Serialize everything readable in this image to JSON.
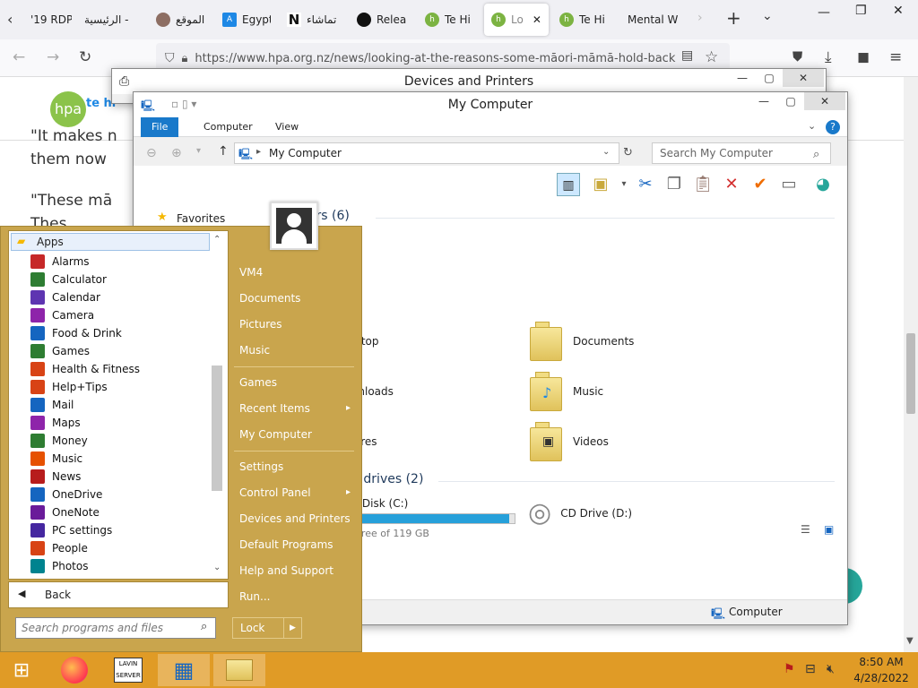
{
  "browser": {
    "tabs": [
      {
        "label": "'19 RDP"
      },
      {
        "label": "الرئيسية -"
      },
      {
        "label": "الموقع"
      },
      {
        "label": "Egypt"
      },
      {
        "label": "تماشاء"
      },
      {
        "label": "Relea"
      },
      {
        "label": "Te Hi"
      },
      {
        "label": "Lo"
      },
      {
        "label": "Te Hi"
      },
      {
        "label": "Mental W"
      }
    ],
    "url": "https://www.hpa.org.nz/news/looking-at-the-reasons-some-māori-māmā-hold-back",
    "window_controls": {
      "minimize": "—",
      "restore": "❐",
      "close": "✕"
    }
  },
  "page": {
    "logo_text": "hpa",
    "logo_sub": "te hi",
    "text_line1": "\"It makes n",
    "text_line2": "them now",
    "text_line3": "\"These mā",
    "text_line4": "Thes"
  },
  "devices_window": {
    "title": "Devices and Printers"
  },
  "explorer": {
    "title": "My Computer",
    "ribbon_tabs": [
      "File",
      "Computer",
      "View"
    ],
    "address": "My Computer",
    "search_placeholder": "Search My Computer",
    "nav_favorites": "Favorites",
    "folders_header": "Folders (6)",
    "folders": [
      {
        "name": "Desktop"
      },
      {
        "name": "Documents"
      },
      {
        "name": "Downloads"
      },
      {
        "name": "Music"
      },
      {
        "name": "Pictures"
      },
      {
        "name": "Videos"
      }
    ],
    "drives_header": "Devices and drives (2)",
    "drives": [
      {
        "name": "Local Disk (C:)",
        "free": "4 GB free of 119 GB",
        "usage_percent": 97
      },
      {
        "name": "CD Drive (D:)"
      }
    ],
    "status": "Computer"
  },
  "start_menu": {
    "apps_label": "Apps",
    "apps": [
      {
        "label": "Alarms",
        "color": "#c62828"
      },
      {
        "label": "Calculator",
        "color": "#2e7d32"
      },
      {
        "label": "Calendar",
        "color": "#5e35b1"
      },
      {
        "label": "Camera",
        "color": "#8e24aa"
      },
      {
        "label": "Food & Drink",
        "color": "#1565c0"
      },
      {
        "label": "Games",
        "color": "#2e7d32"
      },
      {
        "label": "Health & Fitness",
        "color": "#d84315"
      },
      {
        "label": "Help+Tips",
        "color": "#d84315"
      },
      {
        "label": "Mail",
        "color": "#1565c0"
      },
      {
        "label": "Maps",
        "color": "#8e24aa"
      },
      {
        "label": "Money",
        "color": "#2e7d32"
      },
      {
        "label": "Music",
        "color": "#e65100"
      },
      {
        "label": "News",
        "color": "#b71c1c"
      },
      {
        "label": "OneDrive",
        "color": "#1565c0"
      },
      {
        "label": "OneNote",
        "color": "#6a1b9a"
      },
      {
        "label": "PC settings",
        "color": "#4527a0"
      },
      {
        "label": "People",
        "color": "#d84315"
      },
      {
        "label": "Photos",
        "color": "#00838f"
      }
    ],
    "back_label": "Back",
    "search_placeholder": "Search programs and files",
    "right_links": [
      {
        "label": "VM4"
      },
      {
        "label": "Documents"
      },
      {
        "label": "Pictures"
      },
      {
        "label": "Music"
      },
      {
        "label": "Games"
      },
      {
        "label": "Recent Items"
      },
      {
        "label": "My Computer"
      },
      {
        "label": "Settings"
      },
      {
        "label": "Control Panel"
      },
      {
        "label": "Devices and Printers"
      },
      {
        "label": "Default Programs"
      },
      {
        "label": "Help and Support"
      },
      {
        "label": "Run..."
      }
    ],
    "lock_label": "Lock"
  },
  "taskbar": {
    "time": "8:50 AM",
    "date": "4/28/2022",
    "apps": [
      "start",
      "firefox",
      "lavin",
      "control-panel",
      "explorer"
    ]
  }
}
